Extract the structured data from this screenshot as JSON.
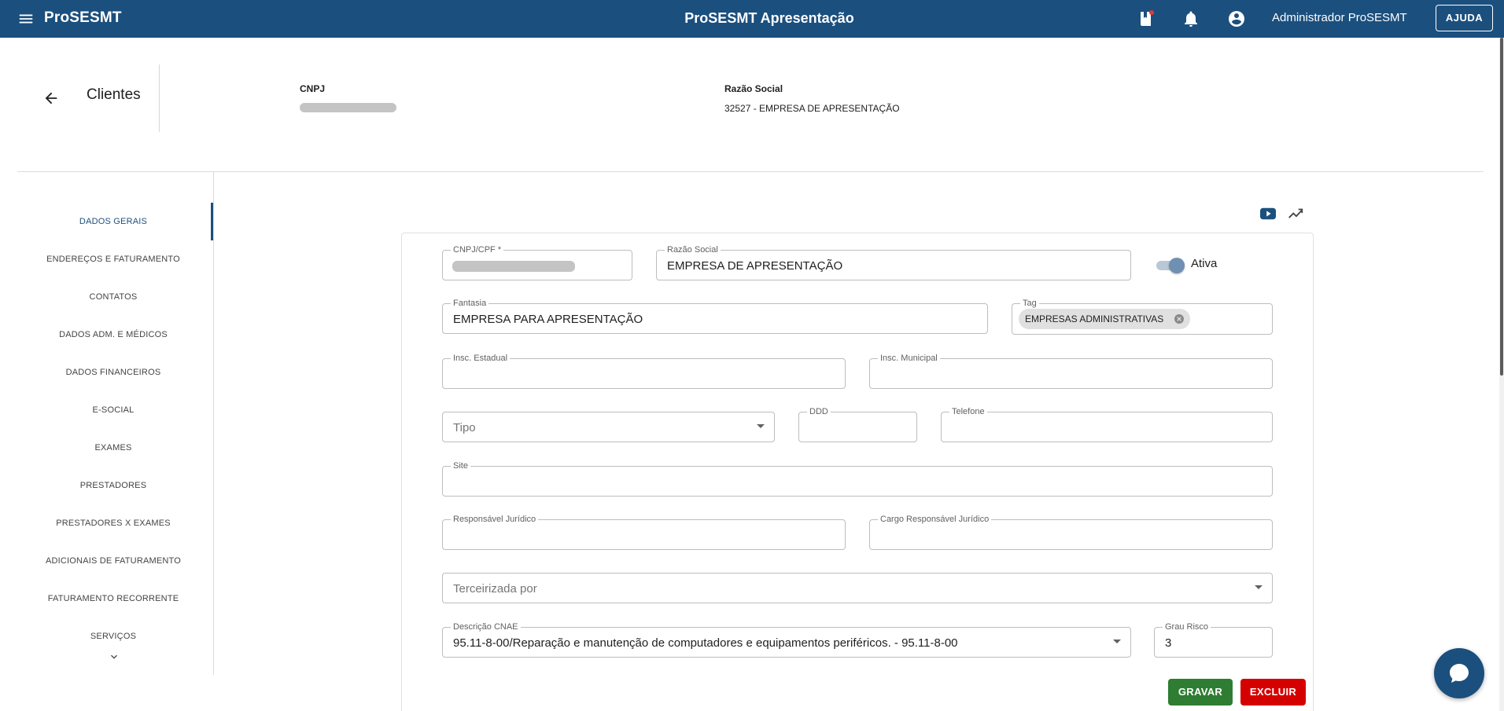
{
  "app": {
    "brand": "ProSESMT",
    "title": "ProSESMT Apresentação",
    "user_name": "Administrador ProSESMT",
    "help_label": "AJUDA"
  },
  "header": {
    "section_title": "Clientes",
    "cnpj_label": "CNPJ",
    "razao_label": "Razão Social",
    "razao_value": "32527 - EMPRESA DE APRESENTAÇÃO"
  },
  "sidebar": {
    "items": [
      {
        "label": "DADOS GERAIS",
        "active": true
      },
      {
        "label": "ENDEREÇOS E FATURAMENTO"
      },
      {
        "label": "CONTATOS"
      },
      {
        "label": "DADOS ADM. E MÉDICOS"
      },
      {
        "label": "DADOS FINANCEIROS"
      },
      {
        "label": "E-SOCIAL"
      },
      {
        "label": "EXAMES"
      },
      {
        "label": "PRESTADORES"
      },
      {
        "label": "PRESTADORES X EXAMES"
      },
      {
        "label": "ADICIONAIS DE FATURAMENTO"
      },
      {
        "label": "FATURAMENTO RECORRENTE"
      },
      {
        "label": "SERVIÇOS"
      }
    ]
  },
  "form": {
    "cnpj_cpf": {
      "label": "CNPJ/CPF *"
    },
    "razao_social": {
      "label": "Razão Social",
      "value": "EMPRESA DE APRESENTAÇÃO"
    },
    "ativa": {
      "label": "Ativa",
      "checked": true
    },
    "fantasia": {
      "label": "Fantasia",
      "value": "EMPRESA PARA APRESENTAÇÃO"
    },
    "tag": {
      "label": "Tag",
      "chip": "EMPRESAS ADMINISTRATIVAS"
    },
    "insc_estadual": {
      "label": "Insc. Estadual",
      "value": ""
    },
    "insc_municipal": {
      "label": "Insc. Municipal",
      "value": ""
    },
    "tipo": {
      "placeholder": "Tipo"
    },
    "ddd": {
      "label": "DDD",
      "value": ""
    },
    "telefone": {
      "label": "Telefone",
      "value": ""
    },
    "site": {
      "label": "Site",
      "value": ""
    },
    "responsavel_juridico": {
      "label": "Responsável Jurídico",
      "value": ""
    },
    "cargo_responsavel": {
      "label": "Cargo Responsável Jurídico",
      "value": ""
    },
    "terceirizada": {
      "placeholder": "Terceirizada por"
    },
    "cnae": {
      "label": "Descrição CNAE",
      "value": "95.11-8-00/Reparação e manutenção de computadores e equipamentos periféricos. - 95.11-8-00"
    },
    "grau_risco": {
      "label": "Grau Risco",
      "value": "3"
    }
  },
  "actions": {
    "save_label": "GRAVAR",
    "delete_label": "EXCLUIR"
  },
  "colors": {
    "primary": "#1b4f7e",
    "save": "#2e7d32",
    "delete": "#d50000"
  }
}
